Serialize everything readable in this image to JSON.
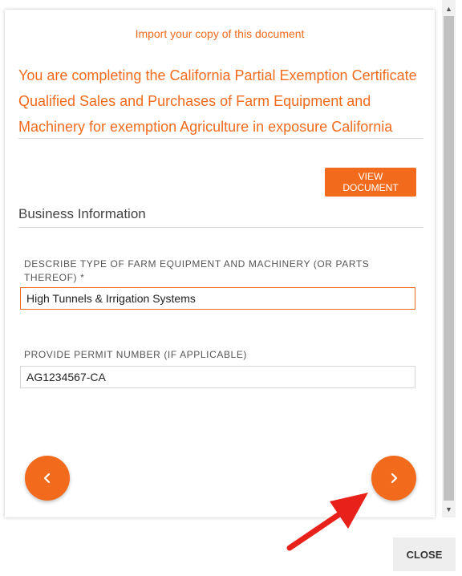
{
  "modal": {
    "import_link": "Import your copy of this document",
    "headline": "You are completing the California Partial Exemption Certificate Qualified Sales and Purchases of Farm Equipment and Machinery for exemption Agriculture in exposure California",
    "view_document_label": "VIEW DOCUMENT",
    "section_title": "Business Information",
    "fields": [
      {
        "label": "DESCRIBE TYPE OF FARM EQUIPMENT AND MACHINERY (OR PARTS THEREOF) *",
        "value": "High Tunnels & Irrigation Systems"
      },
      {
        "label": "PROVIDE PERMIT NUMBER (IF APPLICABLE)",
        "value": "AG1234567-CA"
      }
    ],
    "prev_icon": "chevron-left-icon",
    "next_icon": "chevron-right-icon"
  },
  "footer": {
    "close_label": "CLOSE"
  },
  "annotation": {
    "color": "#e8221b",
    "icon": "red-arrow-icon"
  },
  "colors": {
    "accent": "#f26b1d"
  }
}
